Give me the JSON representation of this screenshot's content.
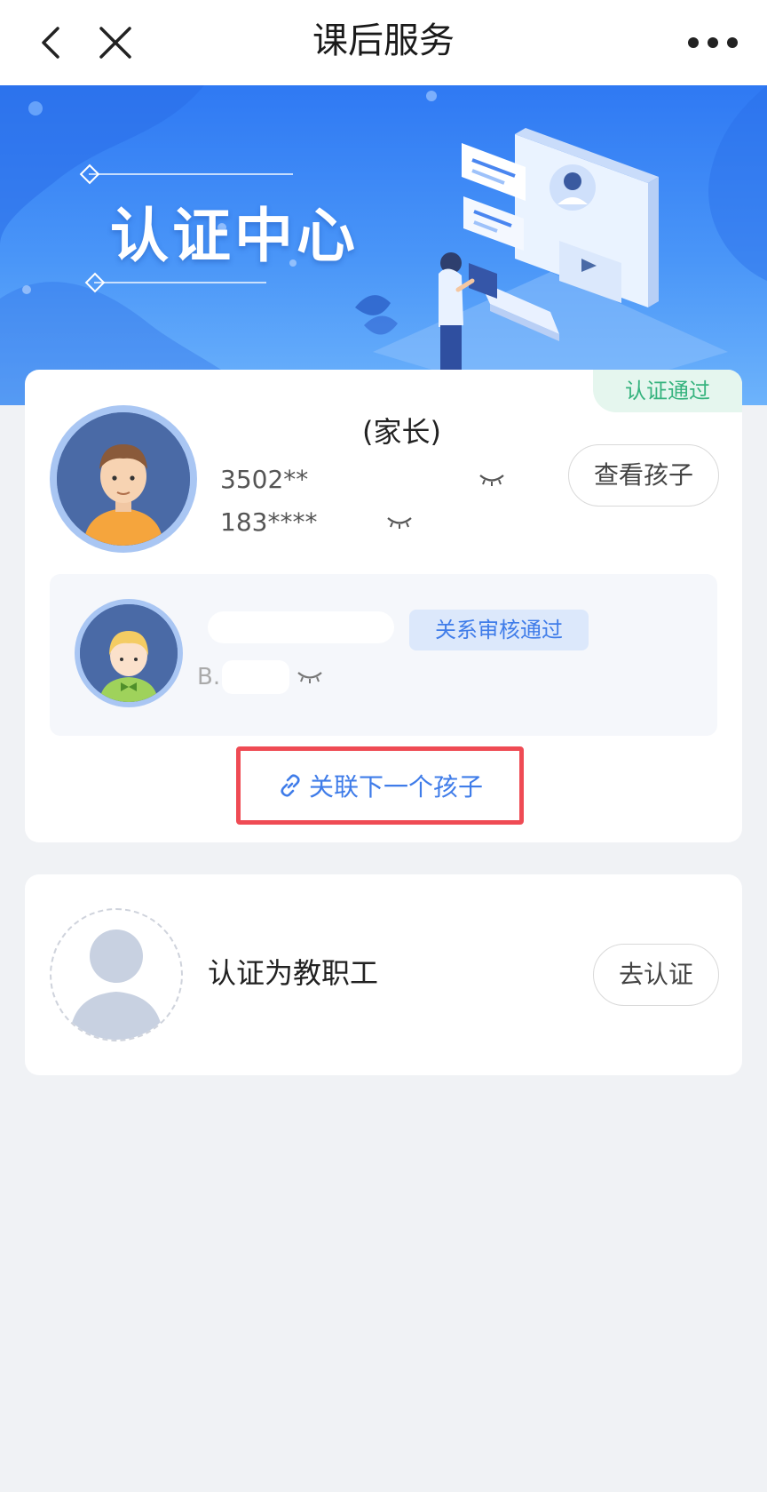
{
  "nav": {
    "title": "课后服务"
  },
  "banner": {
    "title": "认证中心"
  },
  "parent_card": {
    "status_badge": "认证通过",
    "name_suffix": "(家长)",
    "id_number_prefix": "3502**",
    "phone_prefix": "183****",
    "view_children_label": "查看孩子",
    "child": {
      "relation_badge": "关系审核通过",
      "id_prefix": "B."
    },
    "link_next_child_label": "关联下一个孩子"
  },
  "staff_card": {
    "title": "认证为教职工",
    "verify_button_label": "去认证"
  },
  "colors": {
    "accent_blue": "#3f7ce9",
    "success_green": "#36b37e",
    "highlight_red": "#ef4b54",
    "page_background": "#f0f2f5"
  },
  "icons": {
    "back": "chevron-left-icon",
    "close": "close-icon",
    "more": "more-dots-icon",
    "eye_closed": "eye-closed-icon",
    "link": "link-icon"
  }
}
